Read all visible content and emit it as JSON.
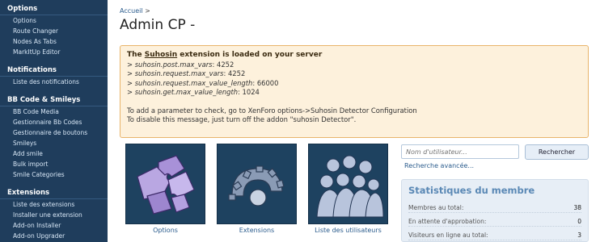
{
  "sidebar": {
    "sections": [
      {
        "title": "Options",
        "items": [
          "Options",
          "Route Changer",
          "Nodes As Tabs",
          "MarkItUp Editor"
        ]
      },
      {
        "title": "Notifications",
        "items": [
          "Liste des notifications"
        ]
      },
      {
        "title": "BB Code & Smileys",
        "items": [
          "BB Code Media",
          "Gestionnaire Bb Codes",
          "Gestionnaire de boutons",
          "Smileys",
          "Add smile",
          "Bulk import",
          "Smile Categories"
        ]
      },
      {
        "title": "Extensions",
        "items": [
          "Liste des extensions",
          "Installer une extension",
          "Add-on Installer",
          "Add-on Upgrader"
        ]
      }
    ]
  },
  "breadcrumb": {
    "home": "Accueil",
    "separator": ">"
  },
  "page_title": "Admin CP -",
  "notice": {
    "head_pre": "The ",
    "head_link": "Suhosin",
    "head_post": " extension is loaded on your server",
    "lines": [
      {
        "key": "suhosin.post.max_vars",
        "value": "4252"
      },
      {
        "key": "suhosin.request.max_vars",
        "value": "4252"
      },
      {
        "key": "suhosin.request.max_value_length",
        "value": "66000"
      },
      {
        "key": "suhosin.get.max_value_length",
        "value": "1024"
      }
    ],
    "footer1": "To add a parameter to check, go to XenForo options->Suhosin Detector Configuration",
    "footer2": "To disable this message, just turn off the addon \"suhosin Detector\"."
  },
  "tiles": [
    {
      "label": "Options",
      "icon": "puzzle-icon"
    },
    {
      "label": "Extensions",
      "icon": "gear-icon"
    },
    {
      "label": "Liste des utilisateurs",
      "icon": "users-icon"
    }
  ],
  "search": {
    "placeholder": "Nom d'utilisateur...",
    "button": "Rechercher",
    "advanced": "Recherche avancée..."
  },
  "stats": {
    "title": "Statistiques du membre",
    "rows": [
      {
        "label": "Membres au total:",
        "value": "38"
      },
      {
        "label": "En attente d'approbation:",
        "value": "0"
      },
      {
        "label": "Visiteurs en ligne au total:",
        "value": "3"
      }
    ]
  },
  "colors": {
    "sidebar_bg": "#1f3d5c",
    "notice_bg": "#fdf1dc",
    "notice_border": "#e8b46a",
    "tile_bg": "#1e4260"
  }
}
